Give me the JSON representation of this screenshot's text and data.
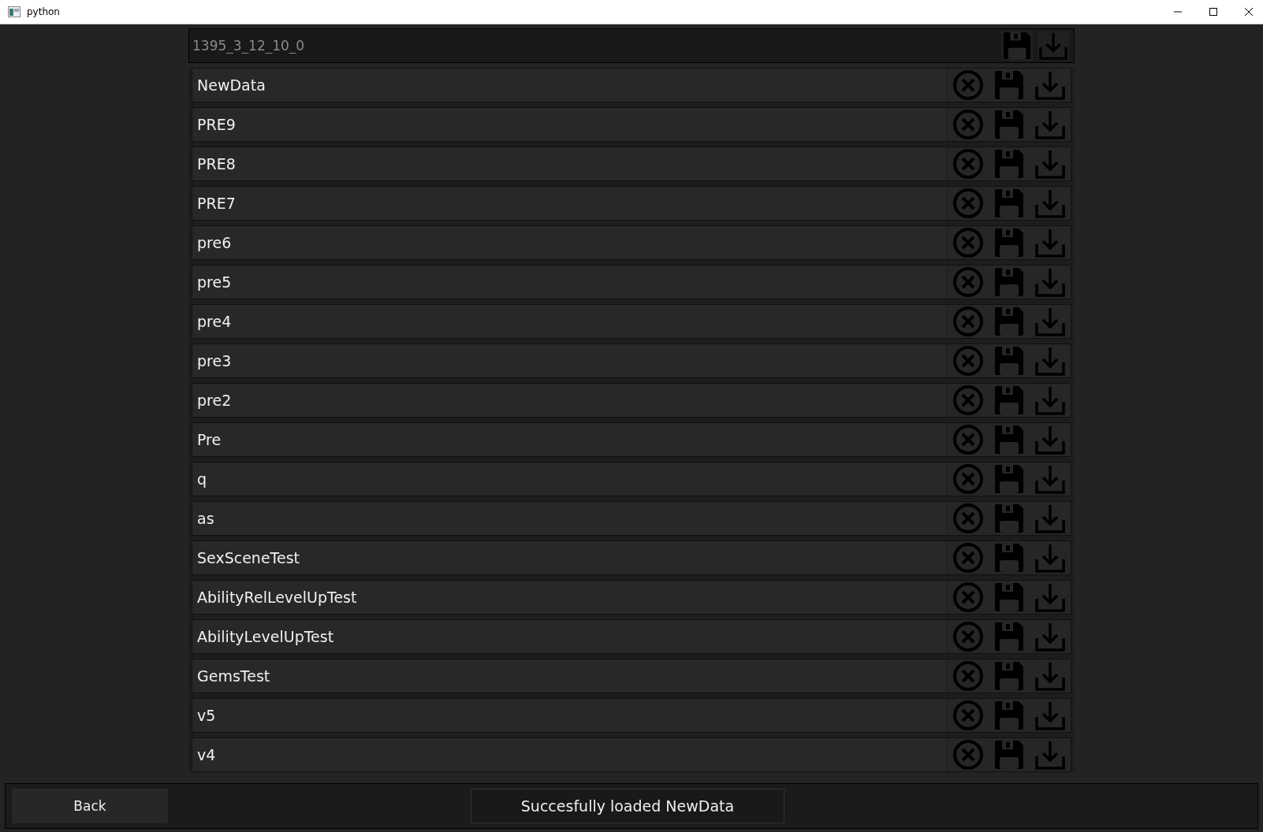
{
  "window": {
    "title": "python"
  },
  "search": {
    "value": "1395_3_12_10_0"
  },
  "entries": [
    {
      "name": "NewData"
    },
    {
      "name": "PRE9"
    },
    {
      "name": "PRE8"
    },
    {
      "name": "PRE7"
    },
    {
      "name": "pre6"
    },
    {
      "name": "pre5"
    },
    {
      "name": "pre4"
    },
    {
      "name": "pre3"
    },
    {
      "name": "pre2"
    },
    {
      "name": "Pre"
    },
    {
      "name": "q"
    },
    {
      "name": "as"
    },
    {
      "name": "SexSceneTest"
    },
    {
      "name": "AbilityRelLevelUpTest"
    },
    {
      "name": "AbilityLevelUpTest"
    },
    {
      "name": "GemsTest"
    },
    {
      "name": "v5"
    },
    {
      "name": "v4"
    }
  ],
  "footer": {
    "back_button": "Back",
    "status": "Succesfully loaded NewData"
  }
}
